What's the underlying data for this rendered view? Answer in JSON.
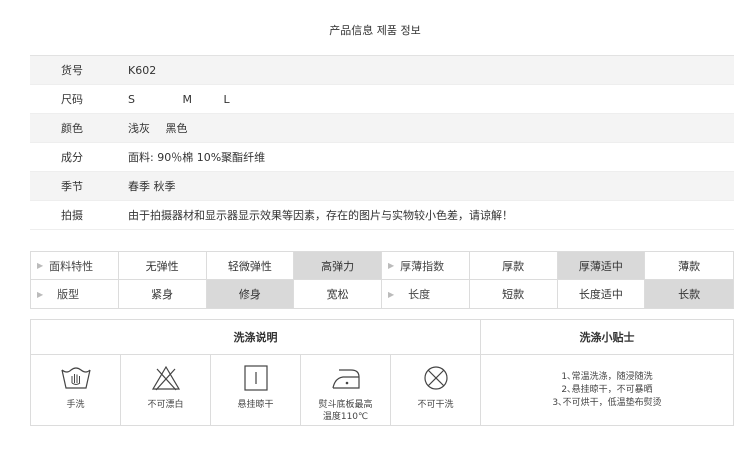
{
  "title": "产品信息  제품 정보",
  "info": [
    {
      "label": "货号",
      "value": "K602"
    },
    {
      "label": "尺码",
      "values": [
        "S",
        "M",
        "L"
      ]
    },
    {
      "label": "颜色",
      "values": [
        "浅灰",
        "黑色"
      ]
    },
    {
      "label": "成分",
      "value": "面料:  90％棉 10%聚酯纤维"
    },
    {
      "label": "季节",
      "value": "春季 秋季"
    },
    {
      "label": "拍摄",
      "value": "由于拍摄器材和显示器显示效果等因素，存在的图片与实物较小色差，请谅解！"
    }
  ],
  "features": {
    "row1": [
      "面料特性",
      "无弹性",
      "轻微弹性",
      "高弹力",
      "厚薄指数",
      "厚款",
      "厚薄适中",
      "薄款"
    ],
    "row2": [
      "版型",
      "紧身",
      "修身",
      "宽松",
      "长度",
      "短款",
      "长度适中",
      "长款"
    ],
    "row1_selected": [
      "高弹力",
      "厚薄适中"
    ],
    "row2_selected": [
      "修身",
      "长款"
    ],
    "highlight_color": "#d9d9d9"
  },
  "care": {
    "wash_header": "洗涤说明",
    "tips_header": "洗涤小贴士",
    "icons": [
      {
        "icon": "hand-wash-icon",
        "caption": "手洗"
      },
      {
        "icon": "no-bleach-icon",
        "caption": "不可漂白"
      },
      {
        "icon": "hang-dry-icon",
        "caption": "悬挂晾干"
      },
      {
        "icon": "iron-icon",
        "caption_lines": [
          "熨斗底板最高",
          "温度110℃"
        ]
      },
      {
        "icon": "no-tumble-dry-icon",
        "caption": "不可干洗"
      }
    ],
    "tips": [
      "1､常温洗涤，随浸随洗",
      "2､悬挂晾干，不可暴晒",
      "3､不可烘干，低温垫布熨烫"
    ]
  }
}
